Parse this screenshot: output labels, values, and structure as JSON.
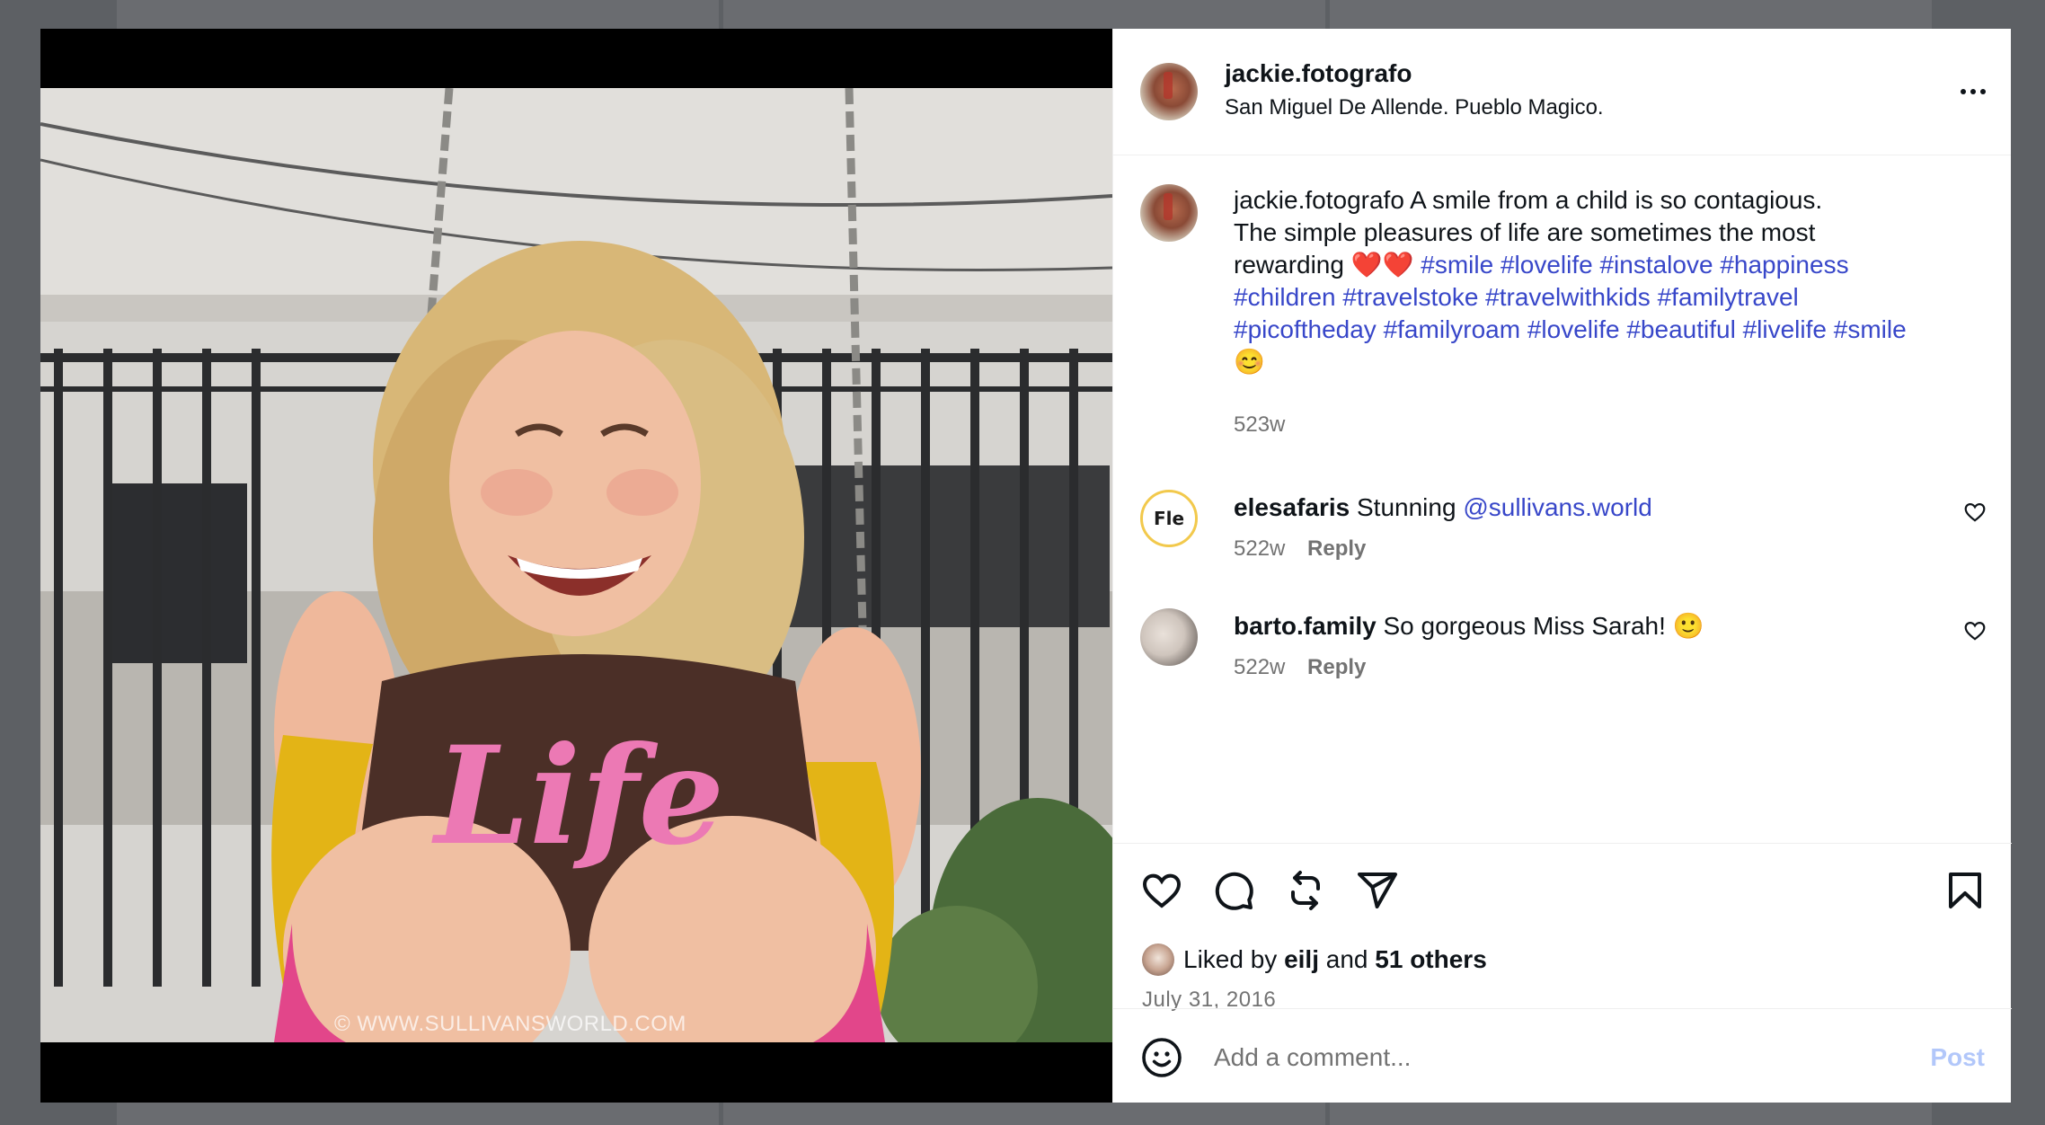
{
  "post": {
    "username": "jackie.fotografo",
    "location": "San Miguel De Allende. Pueblo Magico.",
    "watermark": "© WWW.SULLIVANSWORLD.COM",
    "shirt_text": "Life"
  },
  "caption": {
    "username": "jackie.fotografo",
    "text_line1": "A smile from a child is so contagious.",
    "text_line2": "The simple pleasures of life are sometimes the most",
    "text_line3": "rewarding",
    "hearts": "❤️❤️",
    "hashtags": [
      "#smile",
      "#lovelife",
      "#instalove",
      "#happiness",
      "#children",
      "#travelstoke",
      "#travelwithkids",
      "#familytravel",
      "#picoftheday",
      "#familyroam",
      "#lovelife",
      "#beautiful",
      "#livelife",
      "#smile"
    ],
    "end_emoji": "😊",
    "time": "523w"
  },
  "comments": [
    {
      "username": "elesafaris",
      "text": "Stunning",
      "mention": "@sullivans.world",
      "time": "522w",
      "reply_label": "Reply",
      "avatar_text": "Fle"
    },
    {
      "username": "barto.family",
      "text": "So gorgeous Miss Sarah!",
      "emoji": "🙂",
      "time": "522w",
      "reply_label": "Reply"
    }
  ],
  "likes": {
    "prefix": "Liked by",
    "first_user": "eilj",
    "joiner": "and",
    "others": "51 others"
  },
  "date": "July 31, 2016",
  "add_comment": {
    "placeholder": "Add a comment...",
    "post_label": "Post"
  },
  "colors": {
    "hashtag": "#3847c9",
    "post_disabled": "#b2c7fa",
    "meta": "#737373"
  },
  "icons": {
    "more": "more-options-icon",
    "like": "heart-icon",
    "comment": "comment-icon",
    "repost": "repost-icon",
    "share": "share-icon",
    "save": "bookmark-icon",
    "emoji": "emoji-icon"
  }
}
